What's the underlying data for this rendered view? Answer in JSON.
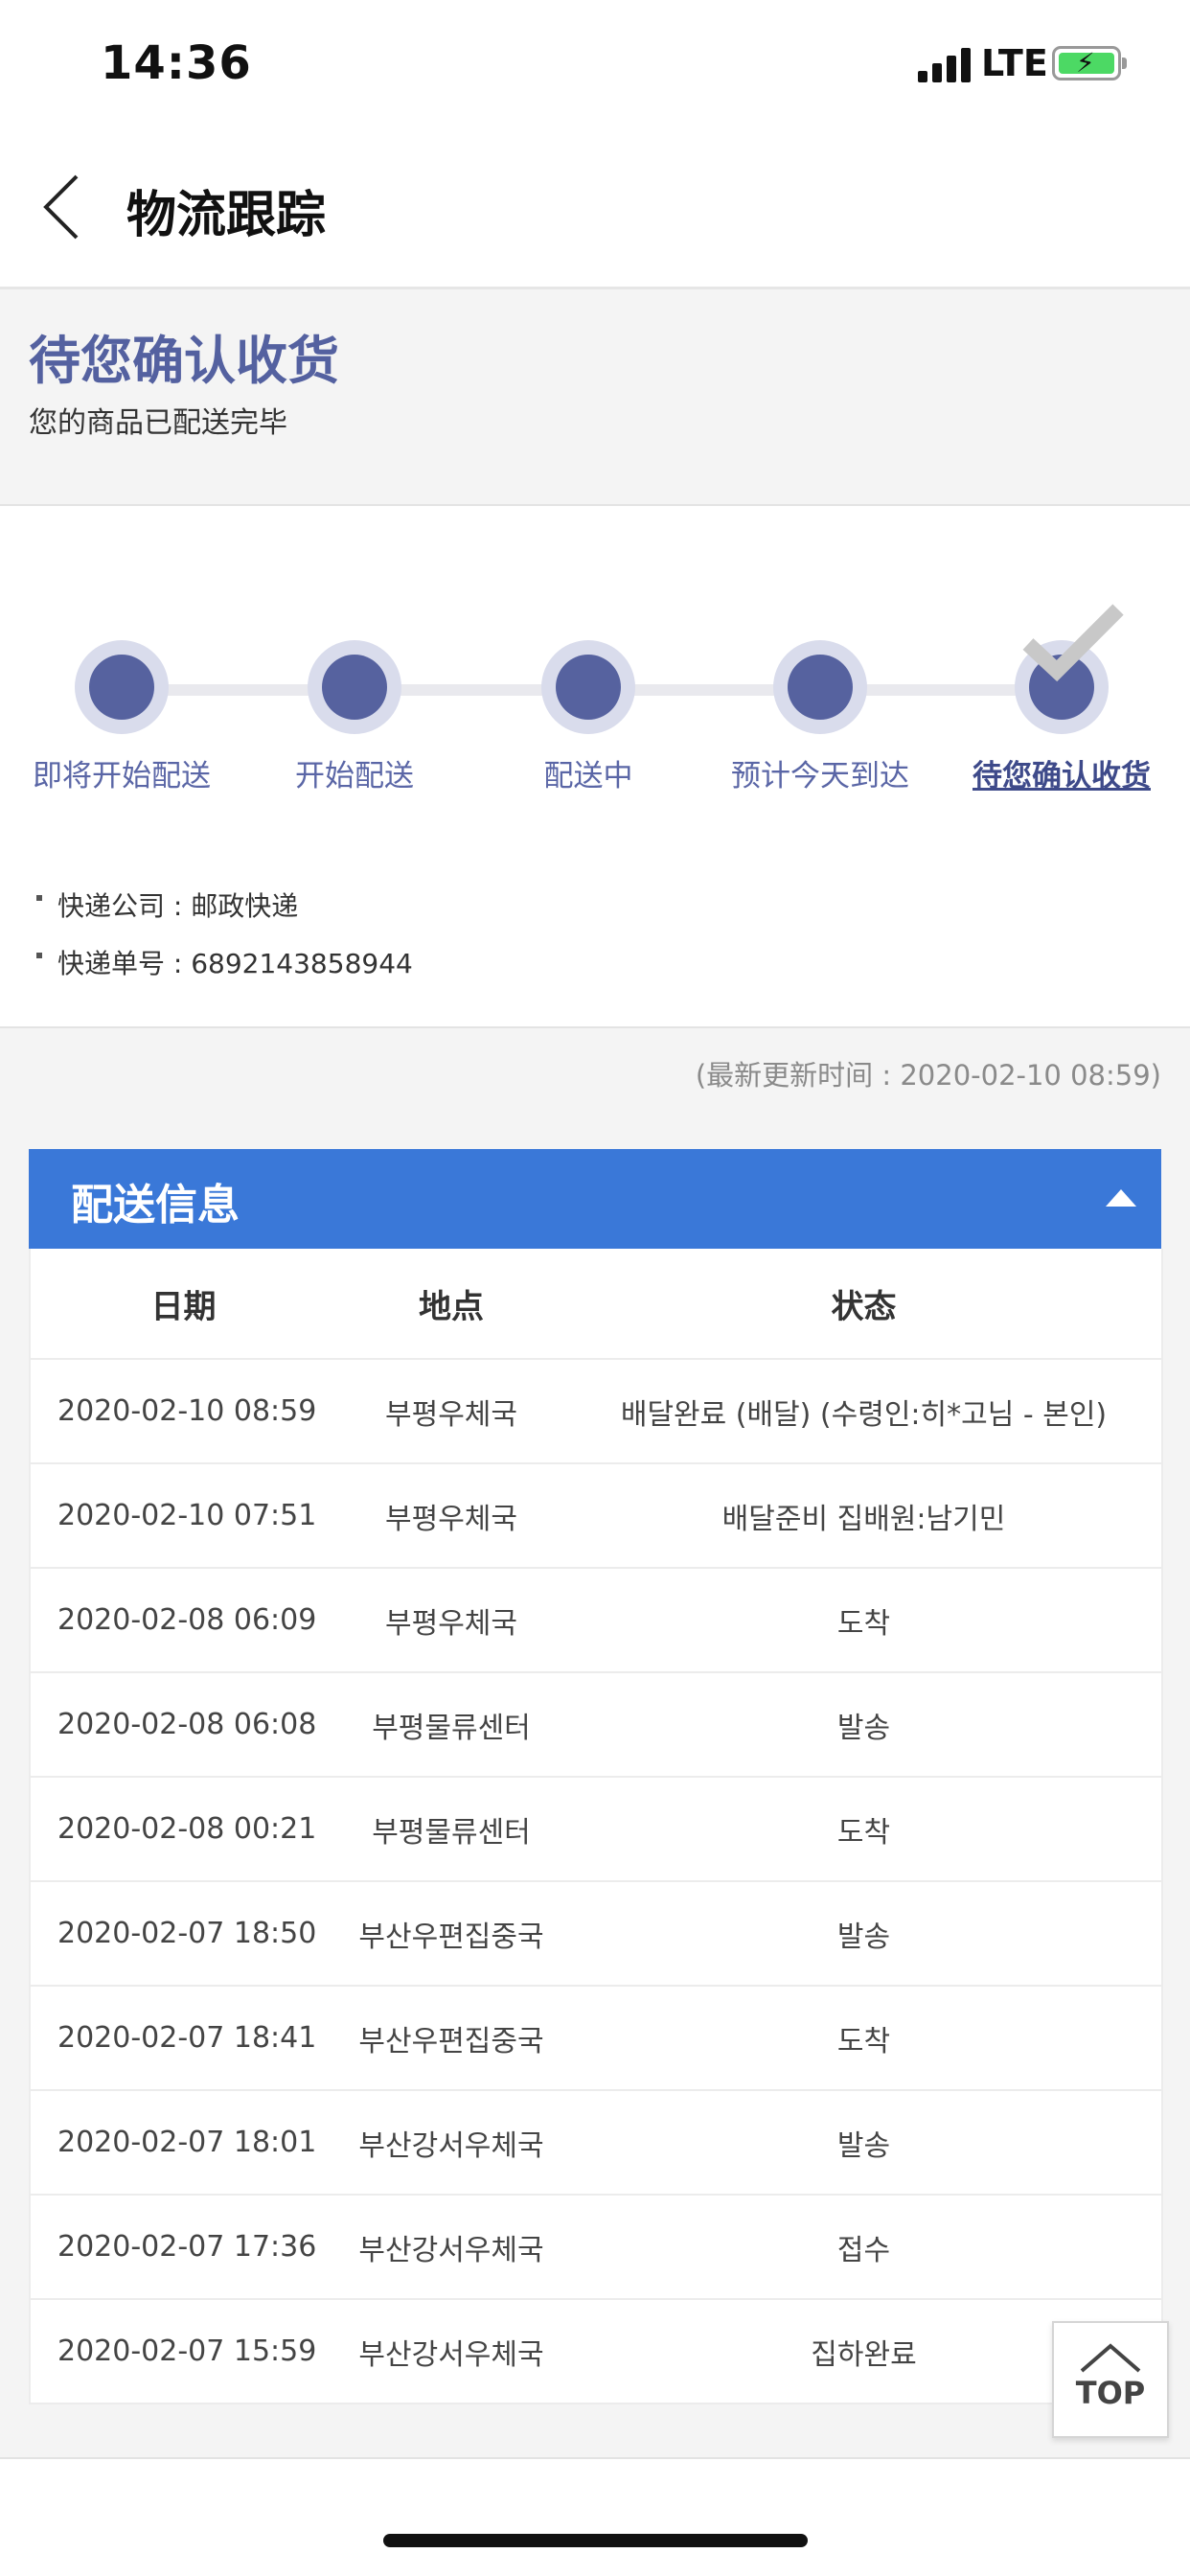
{
  "status_bar": {
    "time": "14:36",
    "network": "LTE"
  },
  "nav": {
    "title": "物流跟踪",
    "back_icon": "chevron-left-icon"
  },
  "summary": {
    "title": "待您确认收货",
    "subtitle": "您的商品已配送完毕"
  },
  "progress": {
    "steps": [
      {
        "label": "即将开始配送"
      },
      {
        "label": "开始配送"
      },
      {
        "label": "配送中"
      },
      {
        "label": "预计今天到达"
      },
      {
        "label": "待您确认收货"
      }
    ],
    "active_step_index": 4,
    "colors": {
      "dot": "#56629f",
      "label": "#5a66a6",
      "track": "#e9e9ee"
    }
  },
  "shipment": {
    "carrier": "快递公司 : 邮政快递",
    "tracking_number": "快递单号 : 6892143858944"
  },
  "last_updated": "(最新更新时间 : 2020-02-10 08:59)",
  "delivery_panel": {
    "title": "配送信息",
    "header_color": "#3a78d8",
    "columns": [
      "日期",
      "地点",
      "状态"
    ],
    "rows": [
      {
        "date": "2020-02-10 08:59",
        "location": "부평우체국",
        "status": "배달완료 (배달) (수령인:히*고님 - 본인)"
      },
      {
        "date": "2020-02-10 07:51",
        "location": "부평우체국",
        "status": "배달준비 집배원:남기민"
      },
      {
        "date": "2020-02-08 06:09",
        "location": "부평우체국",
        "status": "도착"
      },
      {
        "date": "2020-02-08 06:08",
        "location": "부평물류센터",
        "status": "발송"
      },
      {
        "date": "2020-02-08 00:21",
        "location": "부평물류센터",
        "status": "도착"
      },
      {
        "date": "2020-02-07 18:50",
        "location": "부산우편집중국",
        "status": "발송"
      },
      {
        "date": "2020-02-07 18:41",
        "location": "부산우편집중국",
        "status": "도착"
      },
      {
        "date": "2020-02-07 18:01",
        "location": "부산강서우체국",
        "status": "발송"
      },
      {
        "date": "2020-02-07 17:36",
        "location": "부산강서우체국",
        "status": "접수"
      },
      {
        "date": "2020-02-07 15:59",
        "location": "부산강서우체국",
        "status": "집하완료"
      }
    ]
  },
  "top_button": {
    "label": "TOP",
    "icon": "chevron-up-icon"
  }
}
